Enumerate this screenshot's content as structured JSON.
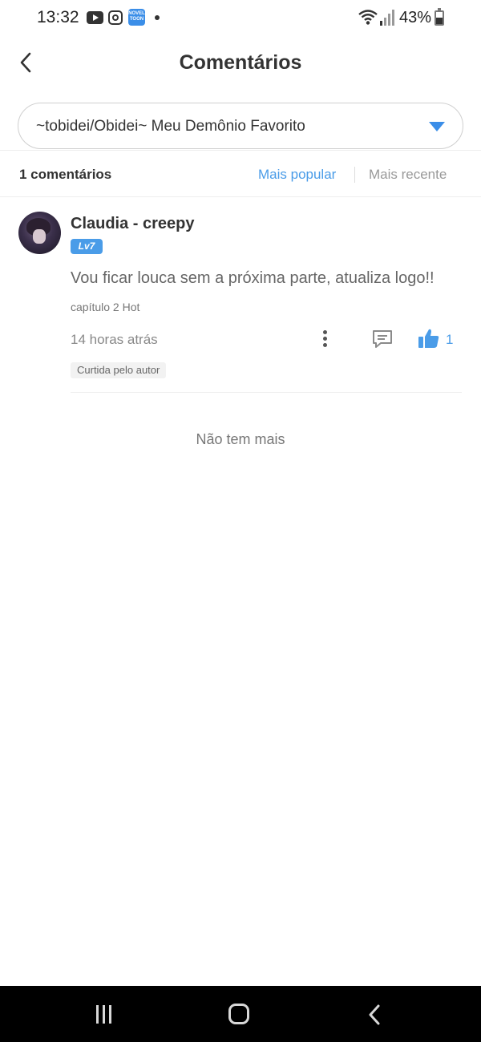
{
  "status_bar": {
    "time": "13:32",
    "battery": "43%",
    "icons": [
      "youtube-icon",
      "instagram-icon",
      "noveltoon-icon",
      "notification-dot-icon",
      "wifi-icon",
      "signal-icon",
      "battery-icon"
    ],
    "noveltoon_label": "NOVEL TOON"
  },
  "header": {
    "title": "Comentários",
    "back_icon": "chevron-left-icon"
  },
  "work_selector": {
    "selected": "~tobidei/Obidei~ Meu Demônio Favorito",
    "arrow_color": "#3b8ee8"
  },
  "sort_bar": {
    "count_label": "1 comentários",
    "popular_label": "Mais popular",
    "recent_label": "Mais recente",
    "active": "Mais popular",
    "active_color": "#4a9ce8"
  },
  "comments": [
    {
      "username": "Claudia - creepy",
      "level": "Lv7",
      "text": "Vou ficar louca sem a próxima parte, atualiza logo!!",
      "chapter": "capítulo 2 Hot",
      "time": "14 horas atrás",
      "likes": "1",
      "author_tag": "Curtida pelo autor"
    }
  ],
  "footer": {
    "no_more": "Não tem mais"
  },
  "nav_bar": {
    "icons": [
      "recent-apps-icon",
      "home-icon",
      "back-icon"
    ]
  }
}
